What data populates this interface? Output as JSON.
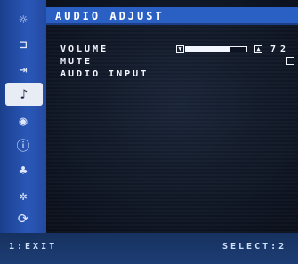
{
  "title": "AUDIO ADJUST",
  "sidebar": {
    "items": [
      {
        "icon": "picture-icon",
        "glyph": "☼"
      },
      {
        "icon": "color-icon",
        "glyph": "⊐"
      },
      {
        "icon": "input-icon",
        "glyph": "⇥"
      },
      {
        "icon": "audio-icon",
        "glyph": "♪",
        "active": true
      },
      {
        "icon": "pip-icon",
        "glyph": "◉"
      },
      {
        "icon": "info-icon",
        "glyph": "ⓘ"
      },
      {
        "icon": "eco-icon",
        "glyph": "♣"
      },
      {
        "icon": "setup-icon",
        "glyph": "✲"
      },
      {
        "icon": "reset-icon",
        "glyph": "⟳"
      }
    ]
  },
  "menu": {
    "volume_label": "VOLUME",
    "mute_label": "MUTE",
    "audio_input_label": "AUDIO INPUT"
  },
  "volume": {
    "value": "72",
    "level_percent": 72,
    "minus_glyph": "▼",
    "plus_glyph": "▲"
  },
  "footer": {
    "exit_label": "1:EXIT",
    "select_label": "SELECT:2"
  },
  "colors": {
    "sidebar_blue": "#2a57b8",
    "title_blue": "#2a5fc4",
    "text": "#f4f6ff"
  }
}
